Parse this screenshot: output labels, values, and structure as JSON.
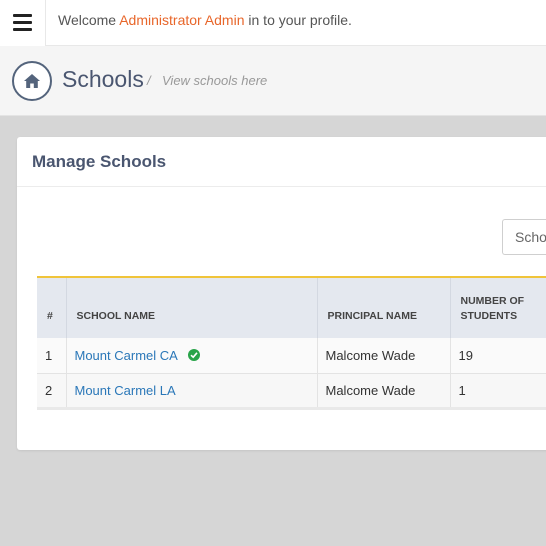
{
  "topbar": {
    "welcome_prefix": "Welcome ",
    "user_name": "Administrator Admin",
    "welcome_suffix": " in to your profile."
  },
  "header": {
    "title": "Schools",
    "separator": "/",
    "subtitle": "View schools here"
  },
  "card": {
    "title": "Manage Schools",
    "search_placeholder": "Schools"
  },
  "table": {
    "columns": [
      "#",
      "SCHOOL NAME",
      "PRINCIPAL NAME",
      "NUMBER OF STUDENTS"
    ],
    "rows": [
      {
        "num": "1",
        "name": "Mount Carmel CA",
        "principal": "Malcome Wade",
        "students": "19",
        "verified": true
      },
      {
        "num": "2",
        "name": "Mount Carmel LA",
        "principal": "Malcome Wade",
        "students": "1",
        "verified": false
      }
    ]
  },
  "colors": {
    "accent_orange": "#e8662a",
    "link_blue": "#2a77b8",
    "table_top_border": "#f0c43a",
    "verified_green": "#2aa44a"
  },
  "icons": {
    "menu": "hamburger-menu-icon",
    "home": "home-icon",
    "verified": "check-circle-icon"
  }
}
